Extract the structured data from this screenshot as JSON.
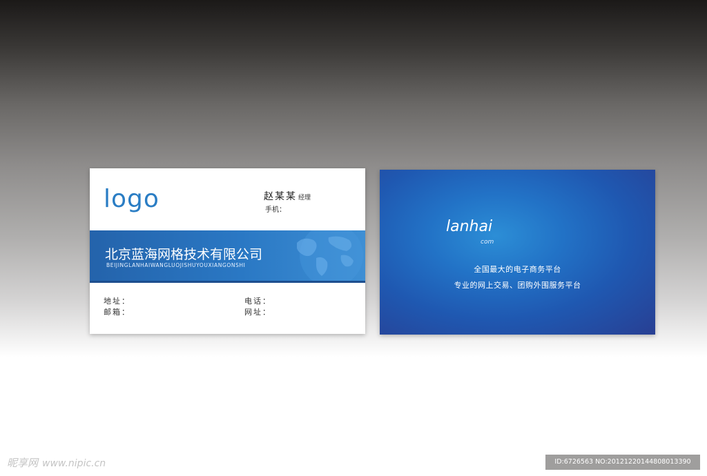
{
  "front": {
    "logo": "logo",
    "name": "赵某某",
    "title": "经理",
    "mobile_label": "手机：",
    "company": "北京蓝海网格技术有限公司",
    "pinyin": "BEIJINGLANHAIWANGLUOJISHUYOUXIANGONSHI",
    "fields": {
      "address": "地址：",
      "phone": "电话：",
      "email": "邮箱：",
      "website": "网址："
    },
    "colors": {
      "brand_blue": "#2a7dc4",
      "band": "#2463ab"
    }
  },
  "back": {
    "brand": "lanhai",
    "brand_sub": "com",
    "slogan1": "全国最大的电子商务平台",
    "slogan2": "专业的网上交易、团购外围服务平台",
    "colors": {
      "center": "#2c8ed6",
      "edge": "#283f93"
    }
  },
  "watermark": {
    "left_text": "昵享网",
    "left_url": "www.nipic.cn",
    "right_text": "ID:6726563 NO:20121220144808013390"
  }
}
